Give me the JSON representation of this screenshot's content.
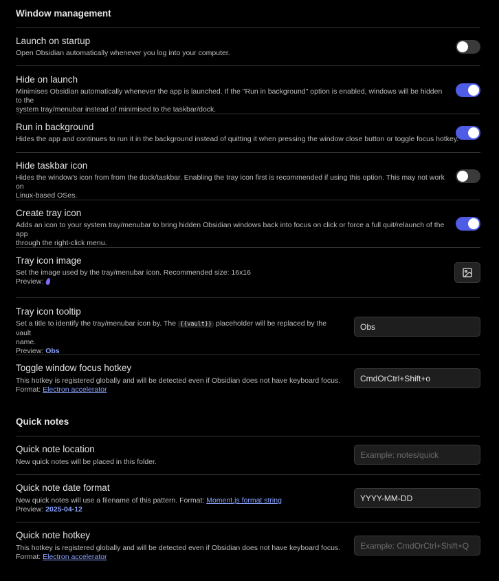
{
  "window_management": {
    "heading": "Window management",
    "launch_on_startup": {
      "title": "Launch on startup",
      "desc": "Open Obsidian automatically whenever you log into your computer.",
      "enabled": false
    },
    "hide_on_launch": {
      "title": "Hide on launch",
      "desc1": "Minimises Obsidian automatically whenever the app is launched. If the \"Run in background\" option is enabled, windows will be hidden to the",
      "desc2": "system tray/menubar instead of minimised to the taskbar/dock.",
      "enabled": true
    },
    "run_in_background": {
      "title": "Run in background",
      "desc": "Hides the app and continues to run it in the background instead of quitting it when pressing the window close button or toggle focus hotkey.",
      "enabled": true
    },
    "hide_taskbar_icon": {
      "title": "Hide taskbar icon",
      "desc1": "Hides the window's icon from from the dock/taskbar. Enabling the tray icon first is recommended if using this option. This may not work on",
      "desc2": "Linux-based OSes.",
      "enabled": false
    },
    "create_tray_icon": {
      "title": "Create tray icon",
      "desc1": "Adds an icon to your system tray/menubar to bring hidden Obsidian windows back into focus on click or force a full quit/relaunch of the app",
      "desc2": "through the right-click menu.",
      "enabled": true
    },
    "tray_icon_image": {
      "title": "Tray icon image",
      "desc": "Set the image used by the tray/menubar icon. Recommended size: 16x16",
      "preview_label": "Preview:",
      "button_icon": "image-icon"
    },
    "tray_icon_tooltip": {
      "title": "Tray icon tooltip",
      "desc_pre": "Set a title to identify the tray/menubar icon by. The",
      "desc_code": "{{vault}}",
      "desc_post": "placeholder will be replaced by the vault",
      "desc2": "name.",
      "preview_label": "Preview:",
      "preview_value": "Obs",
      "value": "Obs"
    },
    "toggle_window_focus_hotkey": {
      "title": "Toggle window focus hotkey",
      "desc": "This hotkey is registered globally and will be detected even if Obsidian does not have keyboard focus.",
      "format_label": "Format:",
      "format_link": "Electron accelerator",
      "value": "CmdOrCtrl+Shift+o"
    }
  },
  "quick_notes": {
    "heading": "Quick notes",
    "location": {
      "title": "Quick note location",
      "desc": "New quick notes will be placed in this folder.",
      "placeholder": "Example: notes/quick"
    },
    "date_format": {
      "title": "Quick note date format",
      "desc": "New quick notes will use a filename of this pattern. Format:",
      "format_link": "Moment.js format string",
      "preview_label": "Preview:",
      "preview_value": "2025-04-12",
      "value": "YYYY-MM-DD"
    },
    "hotkey": {
      "title": "Quick note hotkey",
      "desc": "This hotkey is registered globally and will be detected even if Obsidian does not have keyboard focus.",
      "format_label": "Format:",
      "format_link": "Electron accelerator",
      "placeholder": "Example: CmdOrCtrl+Shift+Q"
    }
  },
  "colors": {
    "accent": "#8aa3ff",
    "toggle_on": "#4f5ce6",
    "background": "#000000"
  }
}
